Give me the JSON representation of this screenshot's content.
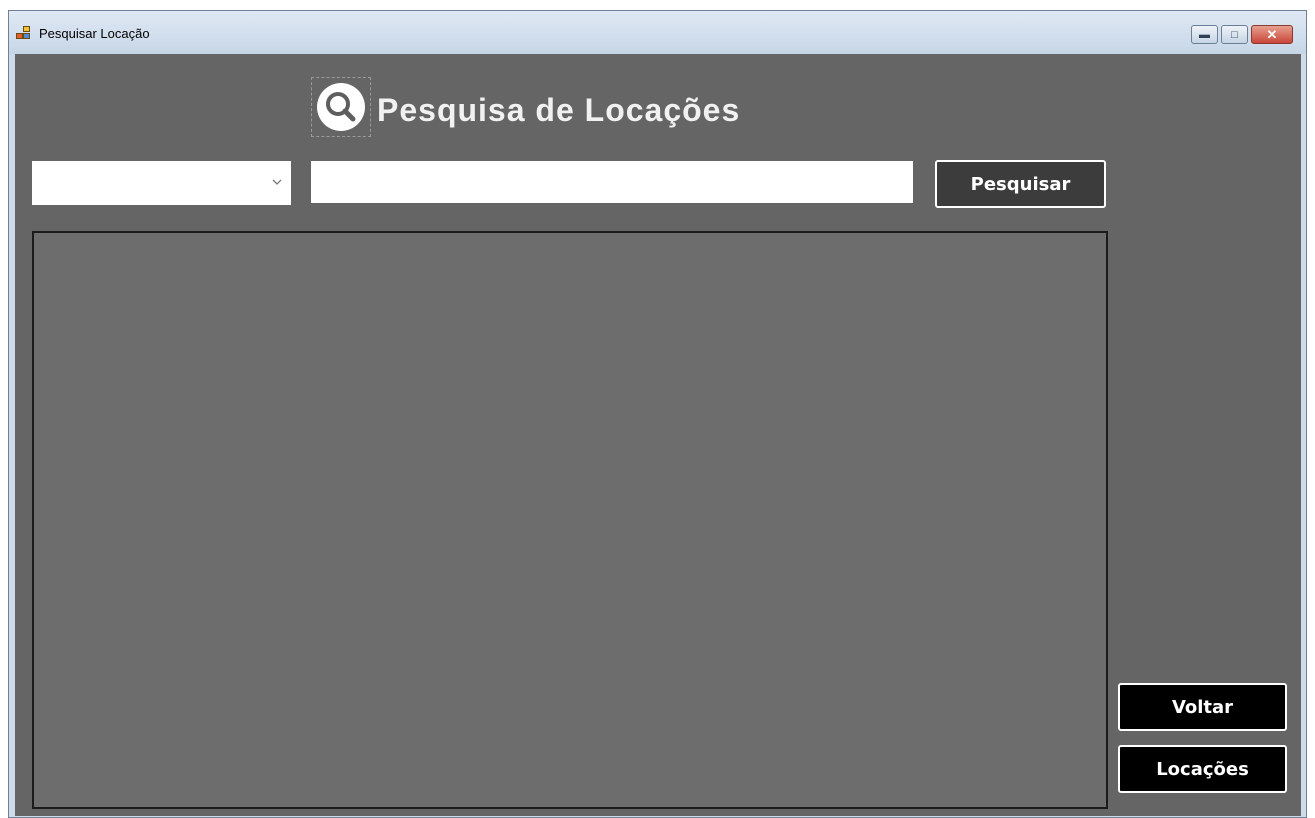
{
  "window": {
    "title": "Pesquisar Locação",
    "controls": {
      "minimize_icon": "minimize-icon",
      "maximize_icon": "maximize-icon",
      "close_icon": "close-icon"
    }
  },
  "header": {
    "title": "Pesquisa de Locações",
    "logo_icon": "search-icon"
  },
  "search": {
    "filter_value": "",
    "query_value": "",
    "submit_label": "Pesquisar"
  },
  "actions": {
    "back_label": "Voltar",
    "rentals_label": "Locações"
  },
  "colors": {
    "background": "#656565",
    "grid": "#6d6d6d",
    "search_button": "#3c3c3c",
    "action_button": "#000000",
    "text": "#ffffff"
  }
}
